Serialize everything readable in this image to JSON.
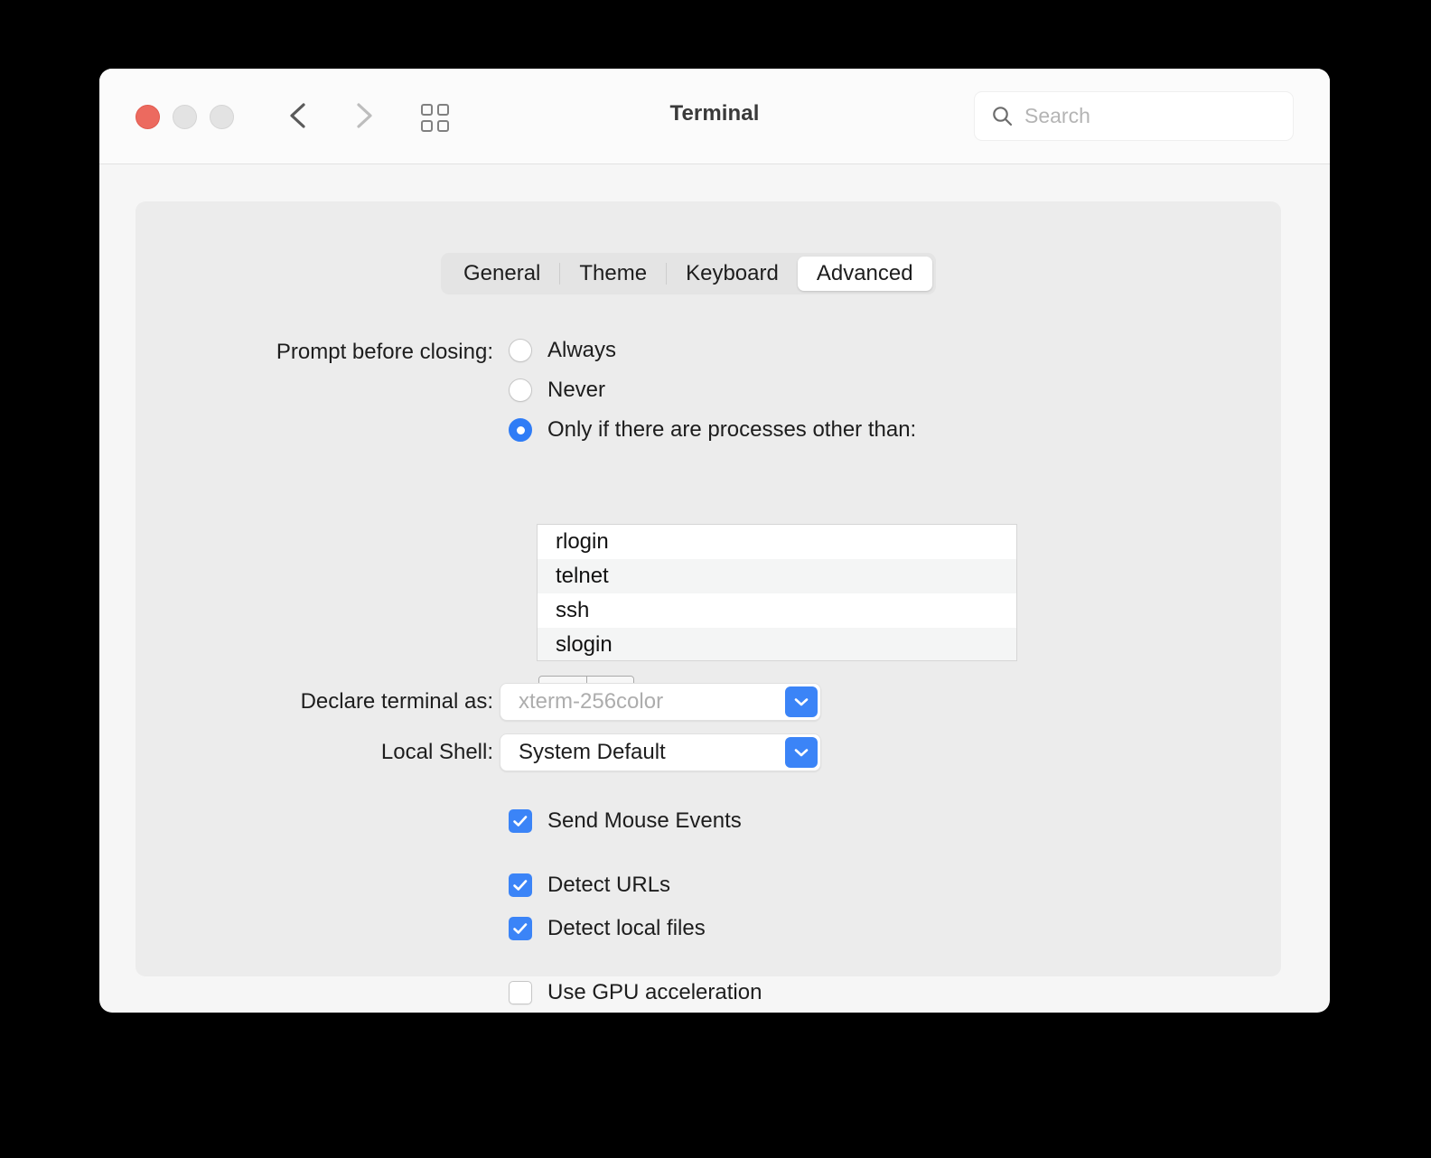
{
  "window": {
    "title": "Terminal",
    "traffic_lights": [
      "close",
      "minimize",
      "maximize"
    ],
    "nav_back_icon": "chevron-left-icon",
    "nav_forward_icon": "chevron-right-icon",
    "grid_icon": "grid-view-icon",
    "accent_color": "#3b84f7",
    "close_color": "#ec6a5f"
  },
  "search": {
    "placeholder": "Search",
    "value": "",
    "icon": "search-icon"
  },
  "tabs": [
    {
      "label": "General",
      "selected": false
    },
    {
      "label": "Theme",
      "selected": false
    },
    {
      "label": "Keyboard",
      "selected": false
    },
    {
      "label": "Advanced",
      "selected": true
    }
  ],
  "prompt_before_closing": {
    "label": "Prompt before closing:",
    "options": [
      {
        "label": "Always",
        "selected": false
      },
      {
        "label": "Never",
        "selected": false
      },
      {
        "label": "Only if there are processes other than:",
        "selected": true
      }
    ]
  },
  "process_list": {
    "items": [
      "rlogin",
      "telnet",
      "ssh",
      "slogin"
    ],
    "add_button_label": "+",
    "remove_button_label": "—",
    "remove_button_enabled": false
  },
  "declare_terminal": {
    "label": "Declare terminal as:",
    "value": "xterm-256color",
    "dimmed": true,
    "chevron_icon": "chevron-down-icon"
  },
  "local_shell": {
    "label": "Local Shell:",
    "value": "System Default",
    "dimmed": false,
    "chevron_icon": "chevron-down-icon"
  },
  "checkboxes": [
    {
      "label": "Send Mouse Events",
      "checked": true
    },
    {
      "label": "Detect URLs",
      "checked": true
    },
    {
      "label": "Detect local files",
      "checked": true
    },
    {
      "label": "Use GPU acceleration",
      "checked": false
    }
  ]
}
